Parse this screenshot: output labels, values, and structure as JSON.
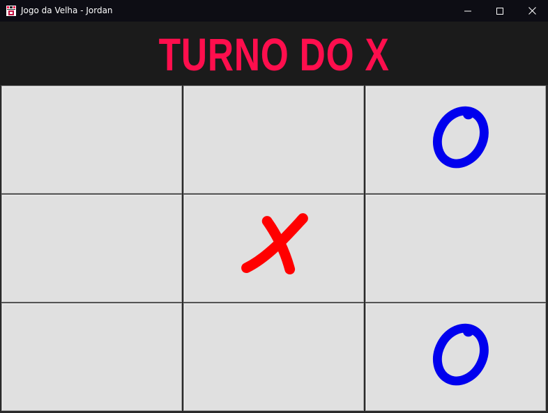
{
  "window": {
    "title": "Jogo da Velha - Jordan",
    "icon": "app-game-icon",
    "controls": [
      "minimize-icon",
      "maximize-icon",
      "close-icon"
    ]
  },
  "status": {
    "text": "TURNO DO X",
    "color": "#ff0e4d"
  },
  "board": {
    "cells": [
      {
        "row": 1,
        "col": 1,
        "mark": ""
      },
      {
        "row": 1,
        "col": 2,
        "mark": ""
      },
      {
        "row": 1,
        "col": 3,
        "mark": "O"
      },
      {
        "row": 2,
        "col": 1,
        "mark": ""
      },
      {
        "row": 2,
        "col": 2,
        "mark": "X"
      },
      {
        "row": 2,
        "col": 3,
        "mark": ""
      },
      {
        "row": 3,
        "col": 1,
        "mark": ""
      },
      {
        "row": 3,
        "col": 2,
        "mark": ""
      },
      {
        "row": 3,
        "col": 3,
        "mark": "O"
      }
    ]
  },
  "colors": {
    "x_mark": "#ff0000",
    "o_mark": "#0000ee",
    "cell_background": "#e0e0e0",
    "header_background": "#1b1b1b"
  }
}
